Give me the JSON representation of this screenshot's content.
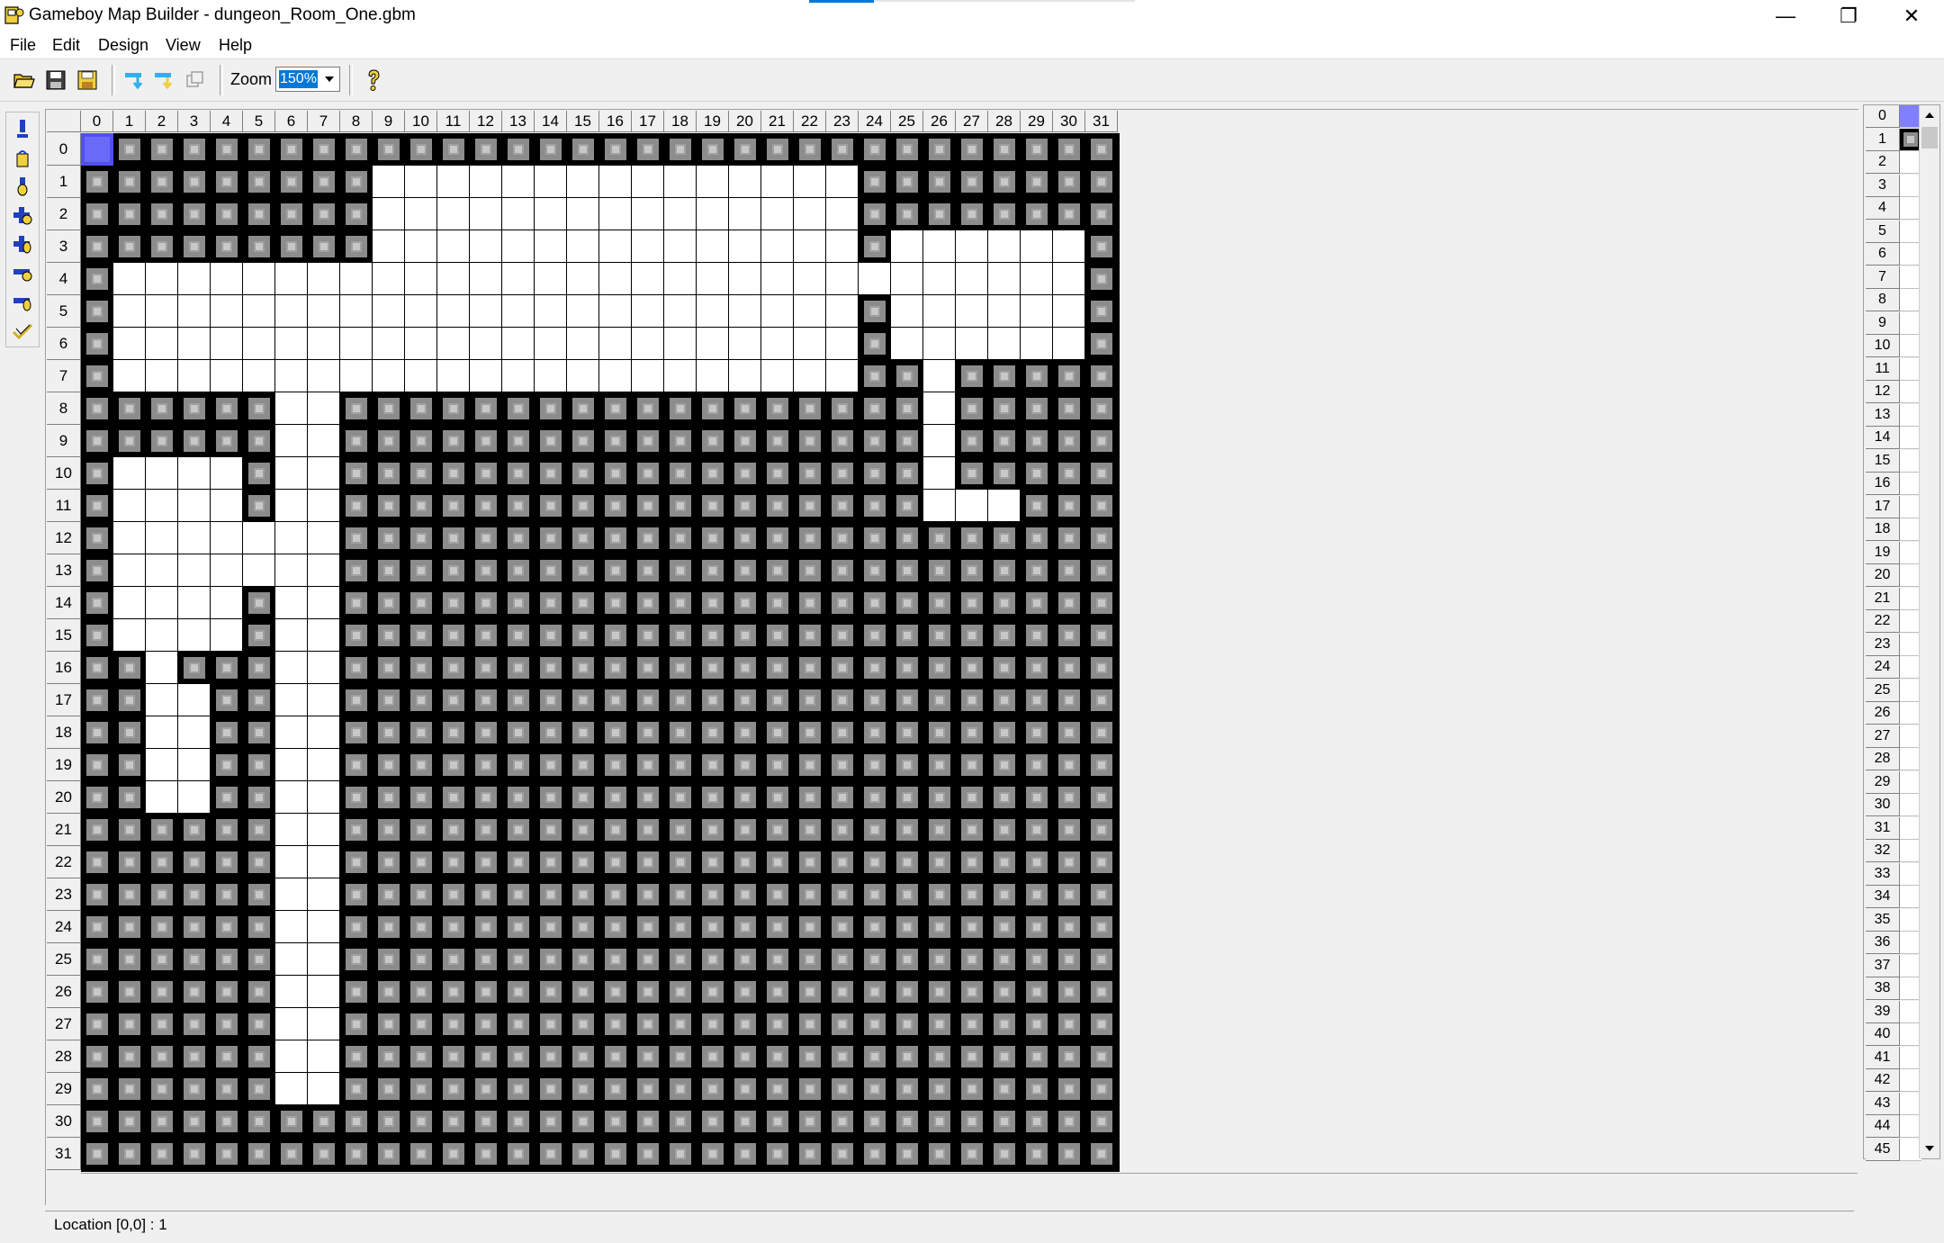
{
  "window": {
    "title": "Gameboy Map Builder - dungeon_Room_One.gbm",
    "minimize": "—",
    "restore": "❐",
    "close": "✕"
  },
  "menu": [
    "File",
    "Edit",
    "Design",
    "View",
    "Help"
  ],
  "toolbar": {
    "zoom_label": "Zoom",
    "zoom_value": "150%",
    "icons": [
      "open-icon",
      "save-icon",
      "save-as-icon",
      "copy-row-icon",
      "copy-col-icon",
      "paste-icon",
      "help-icon"
    ]
  },
  "tools": [
    "pencil-icon",
    "bucket-icon",
    "dropper-icon",
    "insert-row-icon",
    "insert-col-icon",
    "delete-row-icon",
    "delete-col-icon",
    "check-icon"
  ],
  "map": {
    "columns": [
      "0",
      "1",
      "2",
      "3",
      "4",
      "5",
      "6",
      "7",
      "8",
      "9",
      "10",
      "11",
      "12",
      "13",
      "14",
      "15",
      "16",
      "17",
      "18",
      "19",
      "20",
      "21",
      "22",
      "23",
      "24",
      "25",
      "26",
      "27",
      "28",
      "29",
      "30",
      "31"
    ],
    "rows": [
      "0",
      "1",
      "2",
      "3",
      "4",
      "5",
      "6",
      "7",
      "8",
      "9",
      "10",
      "11",
      "12",
      "13",
      "14",
      "15",
      "16",
      "17",
      "18",
      "19",
      "20",
      "21",
      "22",
      "23",
      "24",
      "25",
      "26",
      "27",
      "28",
      "29",
      "30",
      "31"
    ],
    "selected": [
      0,
      0
    ],
    "tiles": [
      "11111111111111111111111111111111",
      "11111111100000000000000011111111",
      "11111111100000000000000011111111",
      "11111111100000000000000010000001",
      "10000000000000000000000000000001",
      "10000000000000000000000010000001",
      "10000000000000000000000010000001",
      "10000000000000000000000011011111",
      "11111100111111111111111111011111",
      "11111100111111111111111111011111",
      "10000100111111111111111111011111",
      "10000100111111111111111111000111",
      "10000000111111111111111111111111",
      "10000000111111111111111111111111",
      "10000100111111111111111111111111",
      "10000100111111111111111111111111",
      "11011100111111111111111111111111",
      "11001100111111111111111111111111",
      "11001100111111111111111111111111",
      "11001100111111111111111111111111",
      "11001100111111111111111111111111",
      "11111100111111111111111111111111",
      "11111100111111111111111111111111",
      "11111100111111111111111111111111",
      "11111100111111111111111111111111",
      "11111100111111111111111111111111",
      "11111100111111111111111111111111",
      "11111100111111111111111111111111",
      "11111100111111111111111111111111",
      "11111100111111111111111111111111",
      "11111111111111111111111111111111",
      "11111111111111111111111111111111"
    ]
  },
  "status": {
    "location": "Location   [0,0] : 1"
  },
  "tileset": {
    "numbers": [
      "0",
      "1",
      "2",
      "3",
      "4",
      "5",
      "6",
      "7",
      "8",
      "9",
      "10",
      "11",
      "12",
      "13",
      "14",
      "15",
      "16",
      "17",
      "18",
      "19",
      "20",
      "21",
      "22",
      "23",
      "24",
      "25",
      "26",
      "27",
      "28",
      "29",
      "30",
      "31",
      "32",
      "33",
      "34",
      "35",
      "36",
      "37",
      "38",
      "39",
      "40",
      "41",
      "42",
      "43",
      "44",
      "45"
    ],
    "swatch_colors": [
      "#8080ff",
      "tile-wall"
    ]
  },
  "colors": {
    "selection": "#5050f0",
    "wall_outer": "#000000",
    "wall_inner": "#8c8c8c",
    "floor": "#ffffff"
  }
}
